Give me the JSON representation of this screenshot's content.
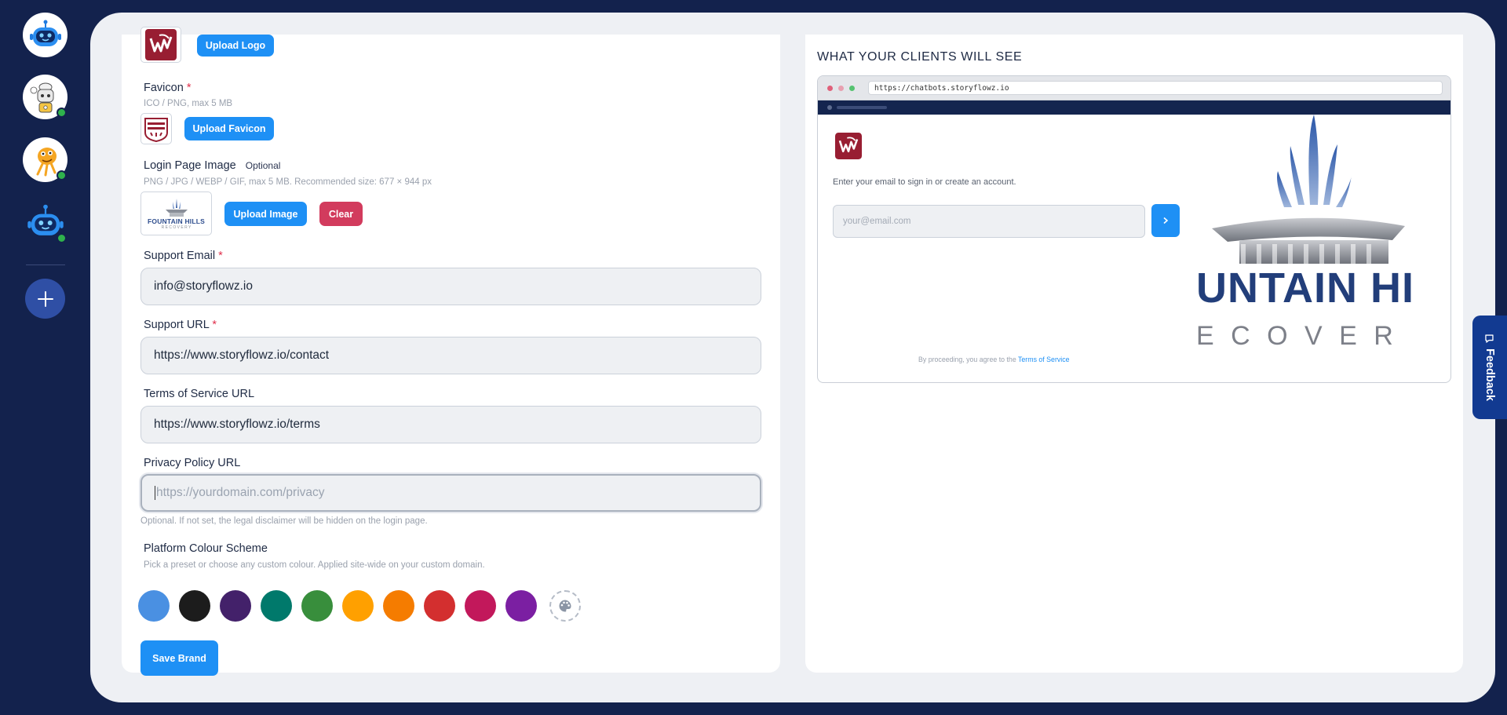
{
  "form": {
    "upload_logo_label": "Upload Logo",
    "favicon_label": "Favicon",
    "favicon_hint": "ICO / PNG, max 5 MB",
    "upload_favicon_label": "Upload Favicon",
    "login_image_label": "Login Page Image",
    "login_image_optional": "Optional",
    "login_image_hint": "PNG / JPG / WEBP / GIF, max 5 MB. Recommended size: 677 × 944 px",
    "login_image_thumb_line1": "FOUNTAIN HILLS",
    "login_image_thumb_line2": "R E C O V E R Y",
    "upload_image_label": "Upload Image",
    "clear_label": "Clear",
    "required_mark": "*",
    "support_email_label": "Support Email",
    "support_email_value": "info@storyflowz.io",
    "support_url_label": "Support URL",
    "support_url_value": "https://www.storyflowz.io/contact",
    "tos_url_label": "Terms of Service URL",
    "tos_url_value": "https://www.storyflowz.io/terms",
    "privacy_url_label": "Privacy Policy URL",
    "privacy_url_placeholder": "https://yourdomain.com/privacy",
    "privacy_url_hint": "Optional. If not set, the legal disclaimer will be hidden on the login page.",
    "colour_scheme_label": "Platform Colour Scheme",
    "colour_scheme_hint": "Pick a preset or choose any custom colour. Applied site-wide on your custom domain.",
    "swatches": [
      "#4a90e2",
      "#1c1c1c",
      "#43216a",
      "#00796b",
      "#388e3c",
      "#ffa000",
      "#f57c00",
      "#d32f2f",
      "#c2185b",
      "#7b1fa2"
    ],
    "save_label": "Save Brand"
  },
  "preview": {
    "title": "WHAT YOUR CLIENTS WILL SEE",
    "url": "https://chatbots.storyflowz.io",
    "prompt": "Enter your email to sign in or create an account.",
    "email_placeholder": "your@email.com",
    "terms_prefix": "By proceeding, you agree to the",
    "terms_link": "Terms of Service",
    "hero_line1": "UNTAIN HI",
    "hero_line2": "E C O V E R"
  },
  "feedback_label": "Feedback",
  "colors": {
    "accent": "#1e90f5",
    "danger": "#d23b5d",
    "rail_bg": "#13224d",
    "online": "#2fb24c"
  },
  "icons": [
    "robot-avatar-icon",
    "robot-chef-avatar-icon",
    "monster-avatar-icon",
    "plus-icon",
    "palette-icon",
    "chevron-right-icon",
    "chat-bubble-icon",
    "wsu-cougar-logo-icon"
  ]
}
